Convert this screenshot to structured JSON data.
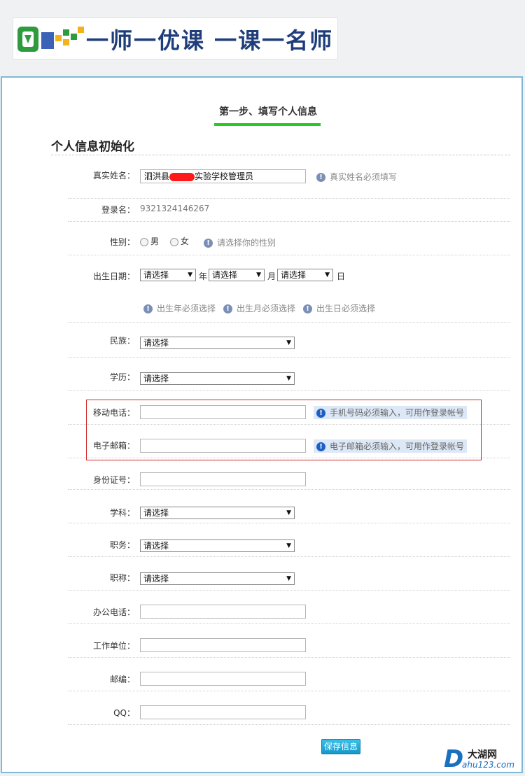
{
  "header": {
    "logo_text": "一师一优课 一课一名师"
  },
  "step": {
    "title": "第一步、填写个人信息"
  },
  "section": {
    "title": "个人信息初始化"
  },
  "form": {
    "real_name": {
      "label": "真实姓名：",
      "value_prefix": "泗洪县",
      "value_suffix": "实验学校管理员",
      "hint": "真实姓名必须填写"
    },
    "login_name": {
      "label": "登录名：",
      "value": "9321324146267"
    },
    "gender": {
      "label": "性别：",
      "option_male": "男",
      "option_female": "女",
      "hint": "请选择你的性别"
    },
    "birth": {
      "label": "出生日期：",
      "year_select": "请选择",
      "year_unit": "年",
      "month_select": "请选择",
      "month_unit": "月",
      "day_select": "请选择",
      "day_unit": "日",
      "hint_year": "出生年必须选择",
      "hint_month": "出生月必须选择",
      "hint_day": "出生日必须选择"
    },
    "ethnicity": {
      "label": "民族：",
      "select": "请选择"
    },
    "education": {
      "label": "学历：",
      "select": "请选择"
    },
    "mobile": {
      "label": "移动电话：",
      "value": "",
      "hint": "手机号码必须输入，可用作登录帐号"
    },
    "email": {
      "label": "电子邮箱：",
      "value": "",
      "hint": "电子邮箱必须输入，可用作登录帐号"
    },
    "id_number": {
      "label": "身份证号：",
      "value": ""
    },
    "subject": {
      "label": "学科：",
      "select": "请选择"
    },
    "position": {
      "label": "职务：",
      "select": "请选择"
    },
    "title": {
      "label": "职称：",
      "select": "请选择"
    },
    "office_phone": {
      "label": "办公电话：",
      "value": ""
    },
    "work_unit": {
      "label": "工作单位：",
      "value": ""
    },
    "postcode": {
      "label": "邮编：",
      "value": ""
    },
    "qq": {
      "label": "QQ：",
      "value": ""
    }
  },
  "actions": {
    "save_label": "保存信息"
  },
  "watermark": {
    "letter": "D",
    "name": "大湖网",
    "url": "ahu123.com"
  },
  "colors": {
    "panel_border": "#7fbad2",
    "step_underline": "#22cc22",
    "highlight_box": "#d12a2a",
    "save_button": "#1498c9"
  }
}
